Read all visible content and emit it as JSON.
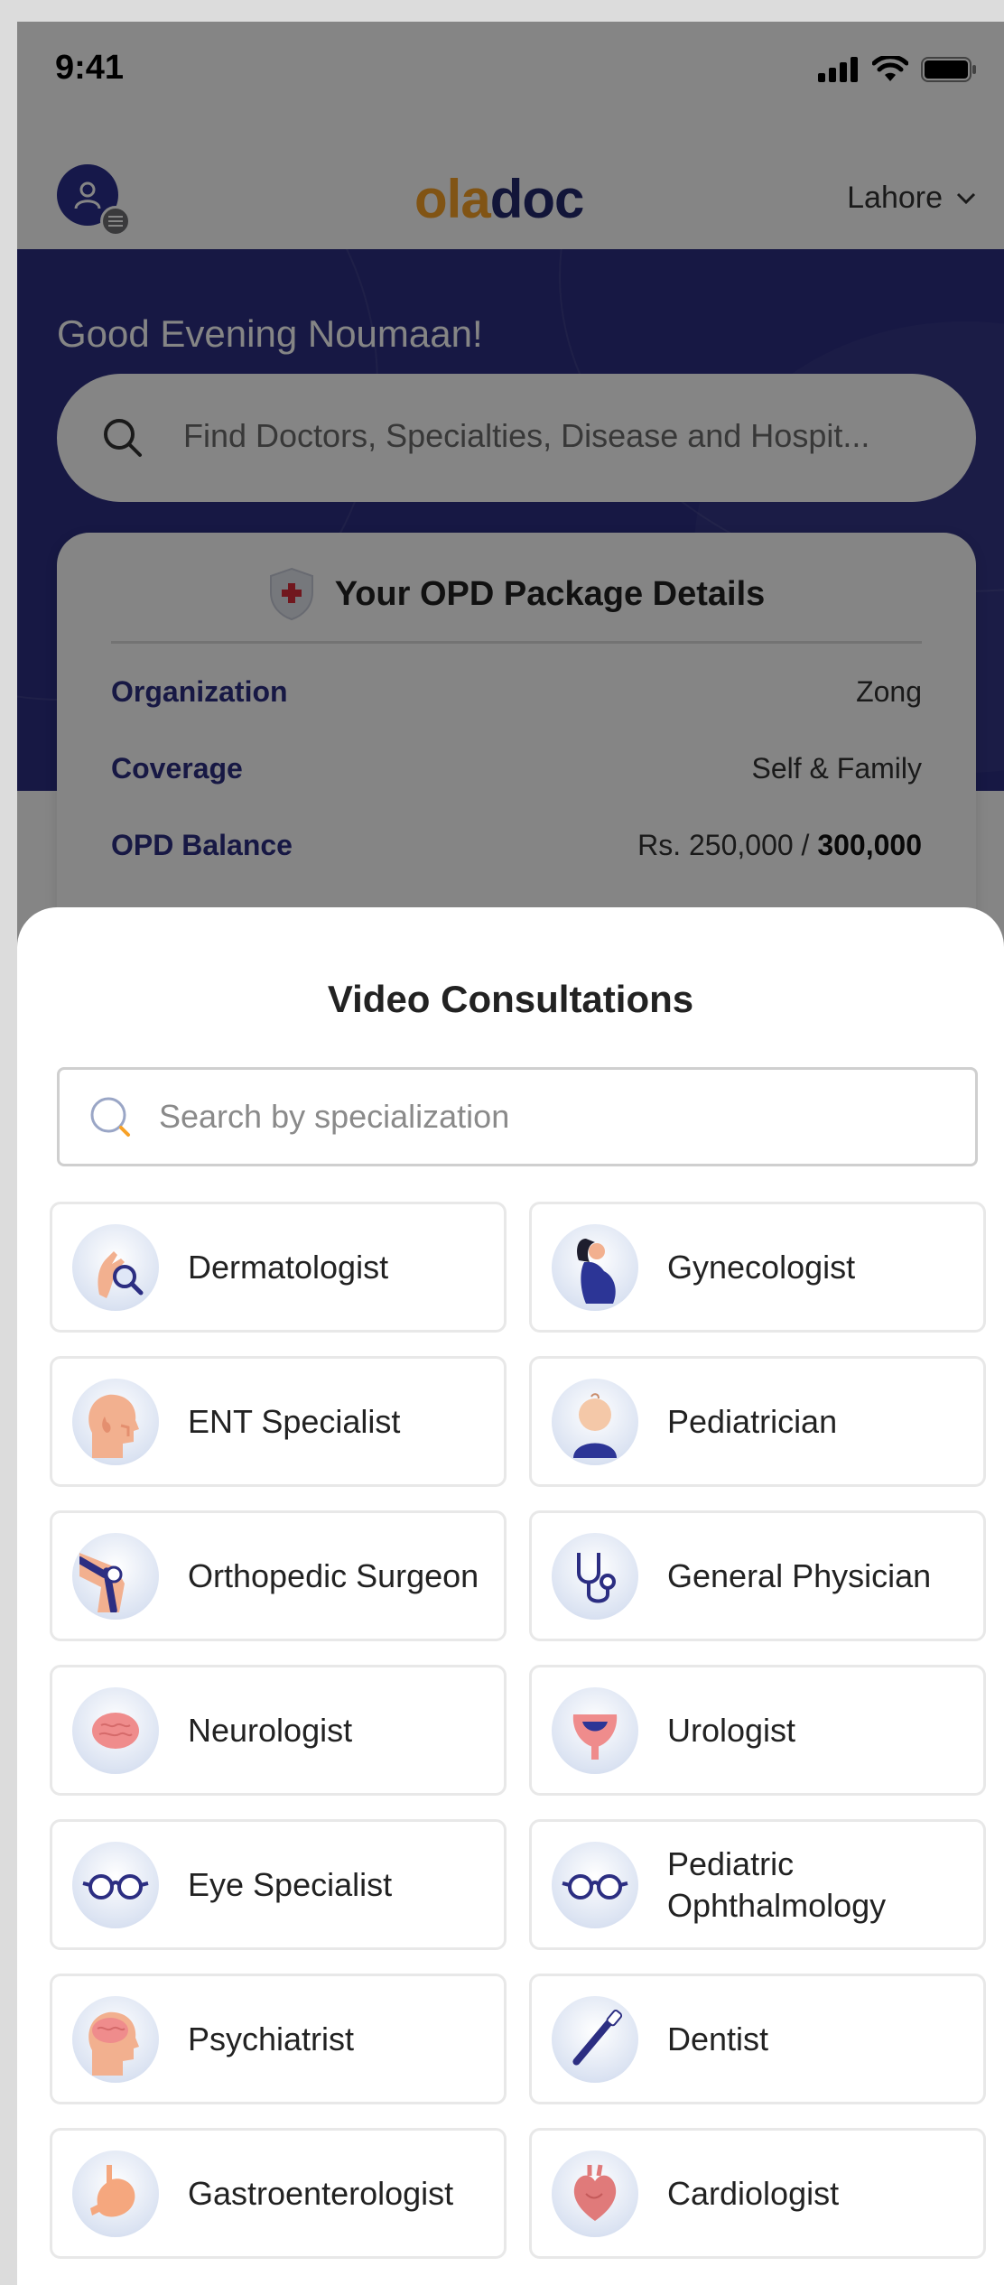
{
  "status_bar": {
    "time": "9:41"
  },
  "header": {
    "logo": {
      "part1": "ola",
      "part2": "doc"
    },
    "city": "Lahore"
  },
  "hero": {
    "greeting": "Good Evening Noumaan!",
    "search_placeholder": "Find Doctors, Specialties, Disease and Hospit..."
  },
  "opd_card": {
    "title": "Your OPD Package Details",
    "rows": [
      {
        "label": "Organization",
        "value": "Zong"
      },
      {
        "label": "Coverage",
        "value": "Self & Family"
      },
      {
        "label": "OPD Balance",
        "value_prefix": "Rs. 250,000 / ",
        "value_bold": "300,000"
      }
    ]
  },
  "sheet": {
    "title": "Video Consultations",
    "search_placeholder": "Search by specialization",
    "specializations": [
      {
        "label": "Dermatologist",
        "icon": "dermatologist-icon"
      },
      {
        "label": "Gynecologist",
        "icon": "gynecologist-icon"
      },
      {
        "label": "ENT Specialist",
        "icon": "ent-icon"
      },
      {
        "label": "Pediatrician",
        "icon": "pediatrician-icon"
      },
      {
        "label": "Orthopedic Surgeon",
        "icon": "knee-icon"
      },
      {
        "label": "General Physician",
        "icon": "stethoscope-icon"
      },
      {
        "label": "Neurologist",
        "icon": "brain-icon"
      },
      {
        "label": "Urologist",
        "icon": "bladder-icon"
      },
      {
        "label": "Eye Specialist",
        "icon": "glasses-icon"
      },
      {
        "label": "Pediatric Ophthalmology",
        "icon": "glasses-icon"
      },
      {
        "label": "Psychiatrist",
        "icon": "head-brain-icon"
      },
      {
        "label": "Dentist",
        "icon": "toothbrush-icon"
      },
      {
        "label": "Gastroenterologist",
        "icon": "stomach-icon"
      },
      {
        "label": "Cardiologist",
        "icon": "heart-icon"
      }
    ]
  },
  "colors": {
    "brand_navy": "#2c2e82",
    "brand_orange": "#f7a127",
    "logo_navy": "#242a6e"
  }
}
